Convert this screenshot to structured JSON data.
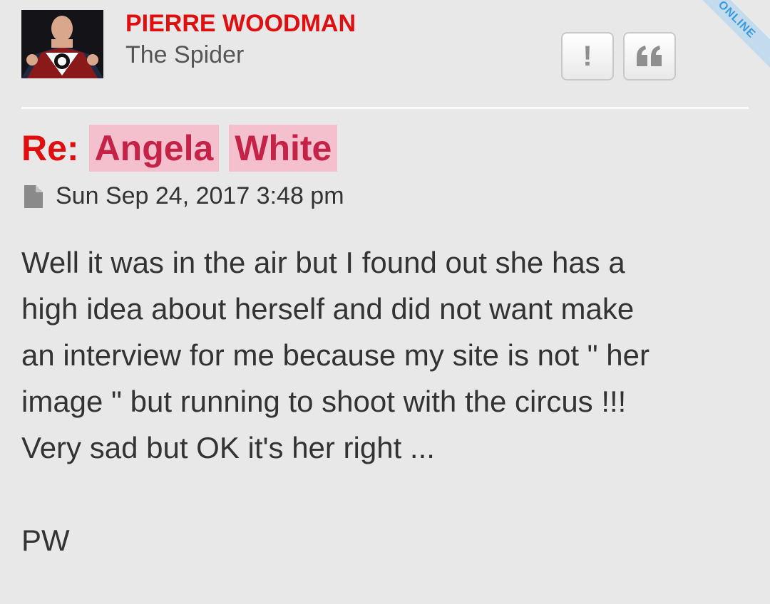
{
  "author": {
    "name": "PIERRE WOODMAN",
    "rank": "The Spider",
    "status": "ONLINE"
  },
  "actions": {
    "report_icon": "!",
    "quote_icon": "quote-icon"
  },
  "post": {
    "title_prefix": "Re:",
    "title_words": [
      "Angela",
      "White"
    ],
    "timestamp": "Sun Sep 24, 2017 3:48 pm",
    "lines": [
      "Well it was in the air but I found out she has a",
      "high idea about herself and did not want make",
      "an interview for me because my site is not \" her",
      "image \" but running to shoot with the circus !!!",
      "Very sad but OK it's her right ..."
    ],
    "signature": "PW"
  },
  "colors": {
    "author": "#e00e0e",
    "highlight_bg": "#f5c0cd",
    "highlight_text": "#c42347",
    "online_ribbon": "#c2dcee",
    "online_text": "#3a9adf"
  }
}
